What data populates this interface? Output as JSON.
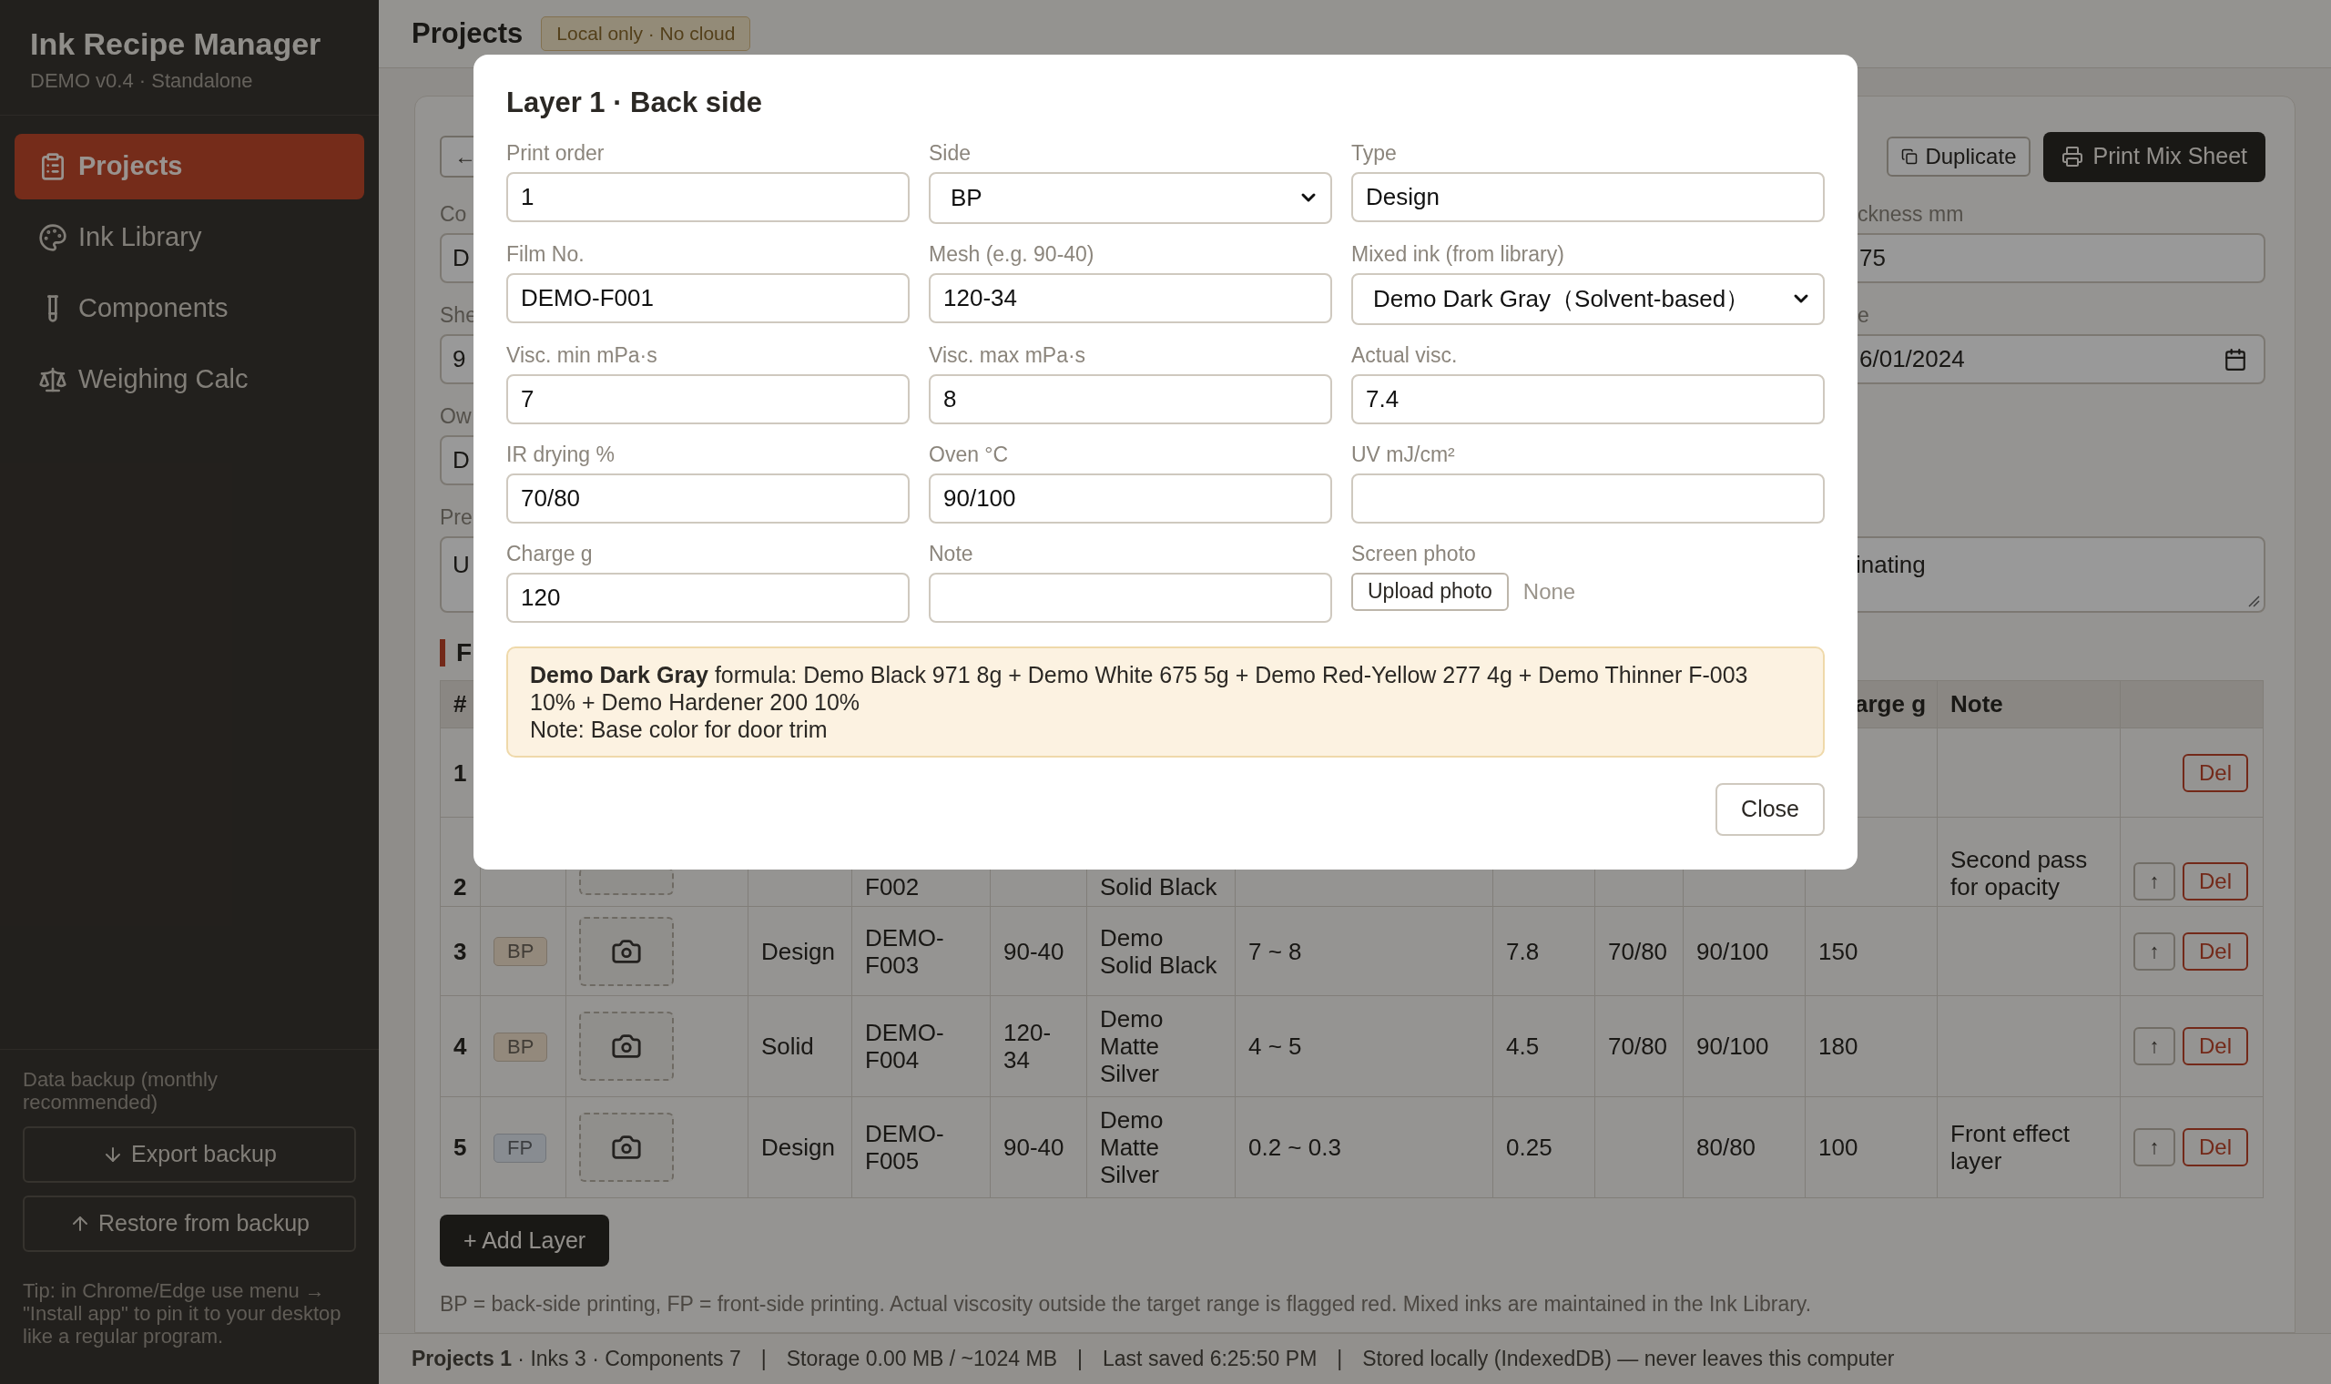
{
  "sidebar": {
    "title": "Ink Recipe Manager",
    "subtitle": "DEMO v0.4 · Standalone",
    "nav": [
      {
        "label": "Projects",
        "selected": true
      },
      {
        "label": "Ink Library",
        "selected": false
      },
      {
        "label": "Components",
        "selected": false
      },
      {
        "label": "Weighing Calc",
        "selected": false
      }
    ],
    "backup_label": "Data backup (monthly recommended)",
    "backup_buttons": [
      {
        "label": "Export backup"
      },
      {
        "label": "Restore from backup"
      }
    ],
    "tip": "Tip: in Chrome/Edge use menu → \"Install app\" to pin it to your desktop like a regular program."
  },
  "header": {
    "title": "Projects",
    "badge": "Local only · No cloud"
  },
  "project": {
    "back_button": "←",
    "actions": [
      {
        "kind": "outline",
        "label": "Duplicate"
      },
      {
        "kind": "primary",
        "label": "Print Mix Sheet"
      }
    ],
    "field_rows": [
      {
        "left": {
          "label": "Co",
          "value": "D"
        },
        "right": {
          "kind": "text",
          "label": "ckness mm",
          "value": "75"
        }
      },
      {
        "left": {
          "label": "She",
          "value": "9"
        },
        "right": {
          "kind": "date",
          "label": "e",
          "value": "6/01/2024"
        }
      },
      {
        "left": {
          "label": "Ow",
          "value": "D"
        }
      }
    ],
    "notes": {
      "label": "Pre",
      "value_start": "U",
      "value_end": "inating"
    }
  },
  "layers": {
    "heading": "F",
    "header": {
      "number": "#",
      "charge": "arge g",
      "note": "Note"
    },
    "rows": [
      {
        "number": "1",
        "delete": "Del"
      },
      {
        "number": "2",
        "photo_frame": true,
        "film": "F002",
        "ink": "Solid Black",
        "note": "Second pass for opacity",
        "move_up": "↑",
        "delete": "Del"
      },
      {
        "number": "3",
        "side": "BP",
        "color": "#93897c",
        "photo_frame": true,
        "type": "Design",
        "film": "DEMO-F003",
        "mesh": "90-40",
        "ink": "Demo Solid Black",
        "visc_range": "7 ~ 8",
        "visc_actual": "7.8",
        "ir": "70/80",
        "oven": "90/100",
        "charge": "150",
        "move_up": "↑",
        "delete": "Del"
      },
      {
        "number": "4",
        "side": "BP",
        "color": "#93897c",
        "photo_frame": true,
        "type": "Solid",
        "film": "DEMO-F004",
        "mesh": "120-34",
        "ink": "Demo Matte Silver",
        "visc_range": "4 ~ 5",
        "visc_actual": "4.5",
        "ir": "70/80",
        "oven": "90/100",
        "charge": "180",
        "move_up": "↑",
        "delete": "Del"
      },
      {
        "number": "5",
        "side": "FP",
        "color": "#888c91",
        "photo_frame": true,
        "type": "Design",
        "film": "DEMO-F005",
        "mesh": "90-40",
        "ink": "Demo Matte Silver",
        "visc_range": "0.2 ~ 0.3",
        "visc_actual": "0.25",
        "oven": "80/80",
        "charge": "100",
        "note": "Front effect layer",
        "move_up": "↑",
        "delete": "Del"
      }
    ],
    "add_button": "+ Add Layer",
    "footnote": "BP = back-side printing, FP = front-side printing. Actual viscosity outside the target range is flagged red. Mixed inks are maintained in the Ink Library."
  },
  "status_bar": [
    "**Projects 1** · Inks 3 · Components 7",
    "|",
    "Storage 0.00 MB / ~1024 MB",
    "|",
    "Last saved 6:25:50 PM",
    "|",
    "Stored locally (IndexedDB) — never leaves this computer"
  ],
  "dialog": {
    "title": "Layer 1 · Back side",
    "fields": [
      {
        "kind": "input",
        "label": "Print order",
        "value": "1"
      },
      {
        "kind": "select",
        "label": "Side",
        "value": "BP"
      },
      {
        "kind": "input",
        "label": "Type",
        "value": "Design"
      },
      {
        "kind": "input",
        "label": "Film No.",
        "value": "DEMO-F001"
      },
      {
        "kind": "input",
        "label": "Mesh (e.g. 90-40)",
        "value": "120-34"
      },
      {
        "kind": "select",
        "label": "Mixed ink (from library)",
        "value": "Demo Dark Gray（Solvent-based）"
      },
      {
        "kind": "input",
        "label": "Visc. min mPa·s",
        "value": "7"
      },
      {
        "kind": "input",
        "label": "Visc. max mPa·s",
        "value": "8"
      },
      {
        "kind": "input",
        "label": "Actual visc.",
        "value": "7.4"
      },
      {
        "kind": "input",
        "label": "IR drying %",
        "value": "70/80"
      },
      {
        "kind": "input",
        "label": "Oven °C",
        "value": "90/100"
      },
      {
        "kind": "input",
        "label": "UV mJ/cm²"
      },
      {
        "kind": "input",
        "label": "Charge g",
        "value": "120"
      },
      {
        "kind": "input",
        "label": "Note"
      },
      {
        "kind": "photo",
        "label": "Screen photo",
        "button": "Upload photo",
        "status": "None"
      }
    ],
    "formula": "**Demo Dark Gray** formula: Demo Black 971 8g + Demo White 675 5g + Demo Red-Yellow 277 4g + Demo Thinner F-003 10% + Demo Hardener 200 10%",
    "formula_note": "Note: Base color for door trim",
    "close": "Close"
  }
}
